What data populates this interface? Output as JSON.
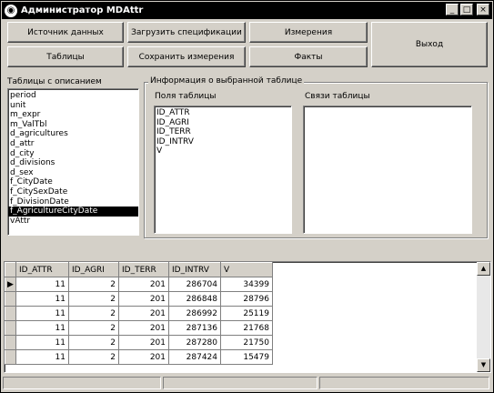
{
  "window": {
    "title": "Администратор MDAttr",
    "app_icon": "app-globe-icon",
    "controls": {
      "minimize": "_",
      "maximize": "□",
      "close": "×"
    }
  },
  "toolbar": {
    "data_source": "Источник данных",
    "load_specs": "Загрузить спецификации",
    "dimensions": "Измерения",
    "exit": "Выход",
    "tables": "Таблицы",
    "save_dimensions": "Сохранить измерения",
    "facts": "Факты"
  },
  "tables_panel": {
    "label": "Таблицы с описанием",
    "items": [
      "period",
      "unit",
      "m_expr",
      "m_ValTbl",
      "d_agricultures",
      "d_attr",
      "d_city",
      "d_divisions",
      "d_sex",
      "f_CityDate",
      "f_CitySexDate",
      "f_DivisionDate",
      "f_AgricultureCityDate",
      "vAttr"
    ],
    "selected_index": 12
  },
  "info_group": {
    "title": "Информация о выбранной таблице",
    "fields_label": "Поля таблицы",
    "fields": [
      "ID_ATTR",
      "ID_AGRI",
      "ID_TERR",
      "ID_INTRV",
      "V"
    ],
    "links_label": "Связи таблицы",
    "links": []
  },
  "grid": {
    "columns": [
      "ID_ATTR",
      "ID_AGRI",
      "ID_TERR",
      "ID_INTRV",
      "V"
    ],
    "rows": [
      [
        "11",
        "2",
        "201",
        "286704",
        "34399"
      ],
      [
        "11",
        "2",
        "201",
        "286848",
        "28796"
      ],
      [
        "11",
        "2",
        "201",
        "286992",
        "25119"
      ],
      [
        "11",
        "2",
        "201",
        "287136",
        "21768"
      ],
      [
        "11",
        "2",
        "201",
        "287280",
        "21750"
      ],
      [
        "11",
        "2",
        "201",
        "287424",
        "15479"
      ]
    ],
    "current_row_marker": "▶",
    "scroll_up": "▲",
    "scroll_down": "▼"
  },
  "colors": {
    "face": "#d4d0c8",
    "title_bg": "#000000",
    "selection": "#000000"
  }
}
